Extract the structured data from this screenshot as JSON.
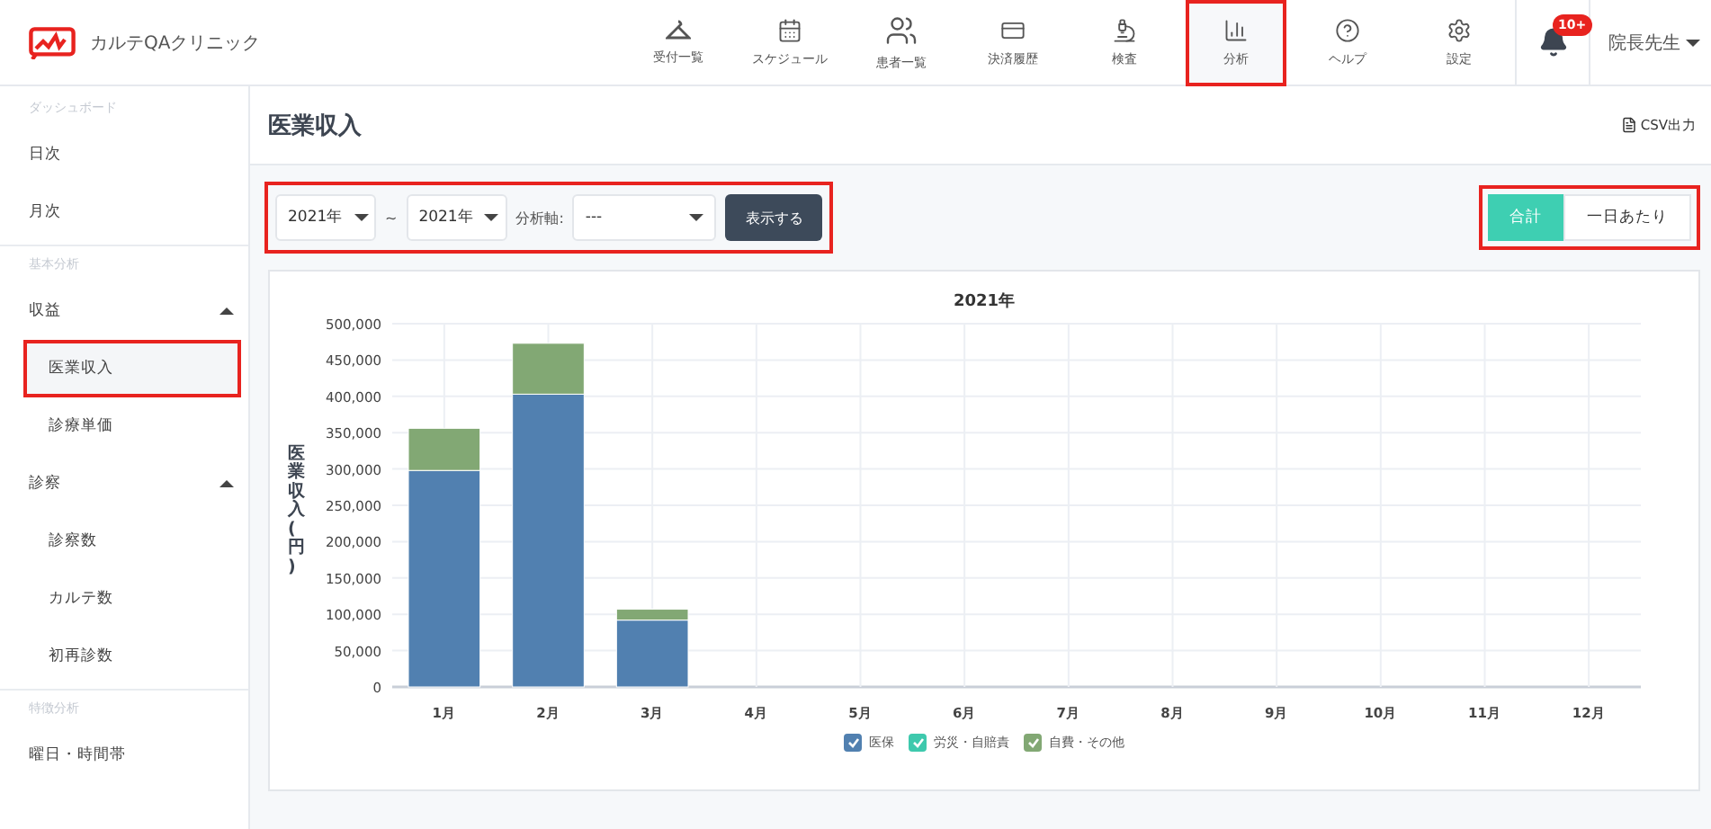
{
  "app": {
    "name": "カルテQAクリニック"
  },
  "nav": [
    {
      "label": "受付一覧",
      "selected": false
    },
    {
      "label": "スケジュール",
      "selected": false
    },
    {
      "label": "患者一覧",
      "selected": false
    },
    {
      "label": "決済履歴",
      "selected": false
    },
    {
      "label": "検査",
      "selected": false
    },
    {
      "label": "分析",
      "selected": true
    },
    {
      "label": "ヘルプ",
      "selected": false
    },
    {
      "label": "設定",
      "selected": false
    }
  ],
  "notifications": {
    "badge": "10+"
  },
  "user": {
    "name": "院長先生"
  },
  "sidebar": [
    {
      "heading": "ダッシュボード",
      "items": [
        {
          "label": "日次",
          "kind": "link",
          "selected": false
        },
        {
          "label": "月次",
          "kind": "link",
          "selected": false
        }
      ]
    },
    {
      "heading": "基本分析",
      "items": [
        {
          "label": "収益",
          "kind": "group",
          "expanded": true,
          "children": [
            {
              "label": "医業収入",
              "kind": "link",
              "selected": true
            },
            {
              "label": "診療単価",
              "kind": "link",
              "selected": false
            }
          ]
        },
        {
          "label": "診察",
          "kind": "group",
          "expanded": true,
          "children": [
            {
              "label": "診察数",
              "kind": "link",
              "selected": false
            },
            {
              "label": "カルテ数",
              "kind": "link",
              "selected": false
            },
            {
              "label": "初再診数",
              "kind": "link",
              "selected": false
            }
          ]
        }
      ]
    },
    {
      "heading": "特徴分析",
      "items": [
        {
          "label": "曜日・時間帯",
          "kind": "link",
          "selected": false
        }
      ]
    }
  ],
  "page": {
    "title": "医業収入",
    "export": "CSV出力"
  },
  "filters": {
    "year_from": "2021年",
    "separator": "~",
    "year_to": "2021年",
    "axis_label": "分析軸:",
    "axis_value": "---",
    "submit": "表示する"
  },
  "mode_toggle": [
    {
      "label": "合計",
      "selected": true
    },
    {
      "label": "一日あたり",
      "selected": false
    }
  ],
  "chart": {
    "ylabel_vertical": "医業収入(円)",
    "legend": [
      {
        "checked": true
      },
      {
        "checked": true
      },
      {
        "checked": true
      }
    ],
    "chart_data": {
      "type": "bar",
      "stacked": true,
      "grid": true,
      "title": "2021年",
      "categories": [
        "1月",
        "2月",
        "3月",
        "4月",
        "5月",
        "6月",
        "7月",
        "8月",
        "9月",
        "10月",
        "11月",
        "12月"
      ],
      "ylim": [
        0,
        500000
      ],
      "yticks": [
        {
          "value": 0,
          "label": "0"
        },
        {
          "value": 50000,
          "label": "50,000"
        },
        {
          "value": 100000,
          "label": "100,000"
        },
        {
          "value": 150000,
          "label": "150,000"
        },
        {
          "value": 200000,
          "label": "200,000"
        },
        {
          "value": 250000,
          "label": "250,000"
        },
        {
          "value": 300000,
          "label": "300,000"
        },
        {
          "value": 350000,
          "label": "350,000"
        },
        {
          "value": 400000,
          "label": "400,000"
        },
        {
          "value": 450000,
          "label": "450,000"
        },
        {
          "value": 500000,
          "label": "500,000"
        }
      ],
      "series": [
        {
          "name": "医保",
          "color": "#5180b0",
          "values": [
            298000,
            403000,
            92000,
            0,
            0,
            0,
            0,
            0,
            0,
            0,
            0,
            0
          ]
        },
        {
          "name": "労災・自賠責",
          "color": "#3ec9ad",
          "values": [
            0,
            0,
            0,
            0,
            0,
            0,
            0,
            0,
            0,
            0,
            0,
            0
          ]
        },
        {
          "name": "自費・その他",
          "color": "#82a874",
          "values": [
            58000,
            70000,
            15000,
            0,
            0,
            0,
            0,
            0,
            0,
            0,
            0,
            0
          ]
        }
      ]
    }
  }
}
